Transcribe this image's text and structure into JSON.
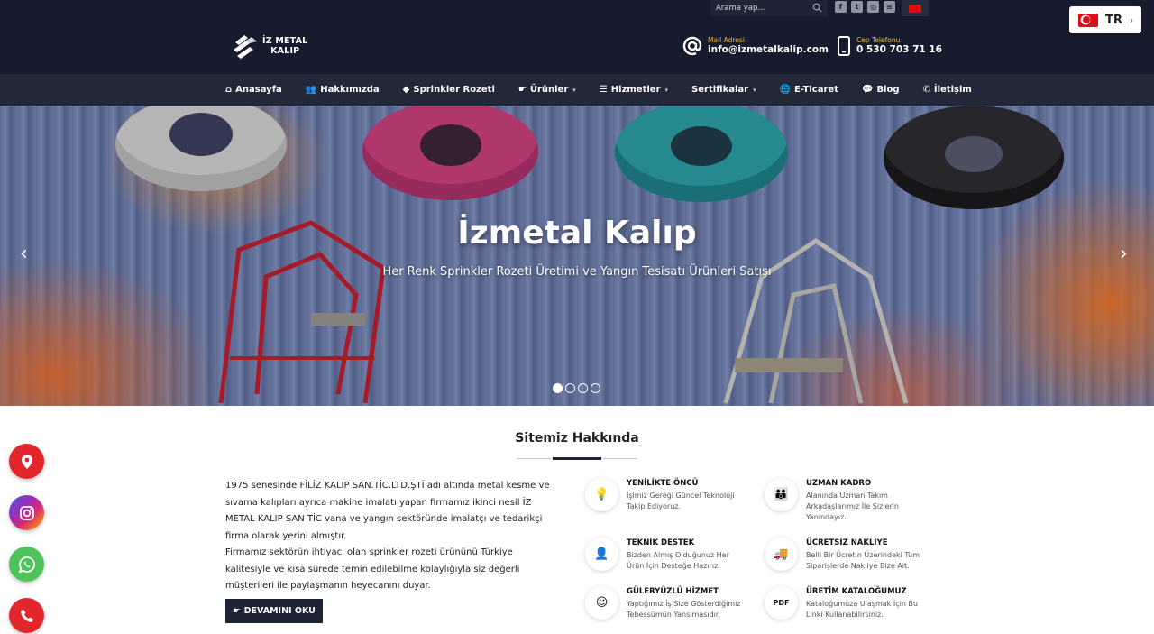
{
  "topbar": {
    "search_placeholder": "Arama yap...",
    "social_icons": [
      "facebook-icon",
      "twitter-icon",
      "instagram-icon",
      "rss-icon"
    ],
    "flag": "turkey-flag-icon"
  },
  "header": {
    "logo_line1": "İZ METAL",
    "logo_line2": "KALIP",
    "mail": {
      "label": "Mail Adresi",
      "value": "info@izmetalkalip.com"
    },
    "phone": {
      "label": "Cep Telefonu",
      "value": "0 530 703 71 16"
    }
  },
  "language": {
    "code": "TR"
  },
  "nav": {
    "items": [
      {
        "label": "Anasayfa",
        "icon": "home-icon"
      },
      {
        "label": "Hakkımızda",
        "icon": "users-icon"
      },
      {
        "label": "Sprinkler Rozeti",
        "icon": "tag-icon"
      },
      {
        "label": "Ürünler",
        "icon": "hand-icon",
        "dropdown": true
      },
      {
        "label": "Hizmetler",
        "icon": "list-icon",
        "dropdown": true
      },
      {
        "label": "Sertifikalar",
        "icon": "",
        "dropdown": true
      },
      {
        "label": "E-Ticaret",
        "icon": "globe-icon"
      },
      {
        "label": "Blog",
        "icon": "comments-icon"
      },
      {
        "label": "İletişim",
        "icon": "phone-icon"
      }
    ]
  },
  "hero": {
    "title": "İzmetal Kalıp",
    "subtitle": "Her Renk Sprinkler Rozeti Üretimi ve Yangın Tesisatı Ürünleri Satışı",
    "slides": 4,
    "active_slide": 1
  },
  "about": {
    "title": "Sitemiz Hakkında",
    "paragraph1": "1975 senesinde FİLİZ KALIP SAN.TİC.LTD.ŞTİ adı altında metal kesme ve sıvama kalıpları ayrıca makine imalatı yapan firmamız ikinci nesil İZ METAL KALIP SAN TİC vana ve yangın sektöründe imalatçı ve tedarikçi firma olarak yerini almıştır.",
    "paragraph2": "Firmamız sektörün ihtiyacı olan sprinkler rozeti ürününü Türkiye kalitesiyle ve kısa sürede temin edilebilme kolaylığıyla siz değerli müşterileri ile paylaşmanın heyecanını duyar.",
    "button": "DEVAMINI OKU"
  },
  "features": [
    {
      "title": "YENİLİKTE ÖNCÜ",
      "desc": "İşimiz Gereği Güncel Teknoloji Takip Ediyoruz.",
      "icon": "lightbulb-icon"
    },
    {
      "title": "UZMAN KADRO",
      "desc": "Alanında Uzman Takım Arkadaşlarımız İle Sizlerin Yanındayız.",
      "icon": "team-icon"
    },
    {
      "title": "TEKNİK DESTEK",
      "desc": "Bizden Almış Olduğunuz Her Ürün İçin Desteğe Hazırız.",
      "icon": "support-icon"
    },
    {
      "title": "ÜCRETSİZ NAKLİYE",
      "desc": "Belli Bir Ücretin Üzerindeki Tüm Siparişlerde Nakliye Bize Ait.",
      "icon": "truck-icon"
    },
    {
      "title": "GÜLERYÜZLÜ HİZMET",
      "desc": "Yaptığımız İş Size Gösterdiğimiz Tebessümün Yansımasıdır.",
      "icon": "smile-icon"
    },
    {
      "title": "ÜRETİM KATALOĞUMUZ",
      "desc": "Kataloğumuza Ulaşmak İçin Bu Linki Kullanabilirsiniz.",
      "icon": "pdf-icon"
    }
  ],
  "floating_buttons": [
    "map-pin-icon",
    "instagram-icon",
    "whatsapp-icon",
    "phone-icon"
  ],
  "colors": {
    "navy": "#161c2d",
    "nav": "#222838",
    "accent_yellow": "#f2b63d",
    "button": "#1e2435"
  }
}
